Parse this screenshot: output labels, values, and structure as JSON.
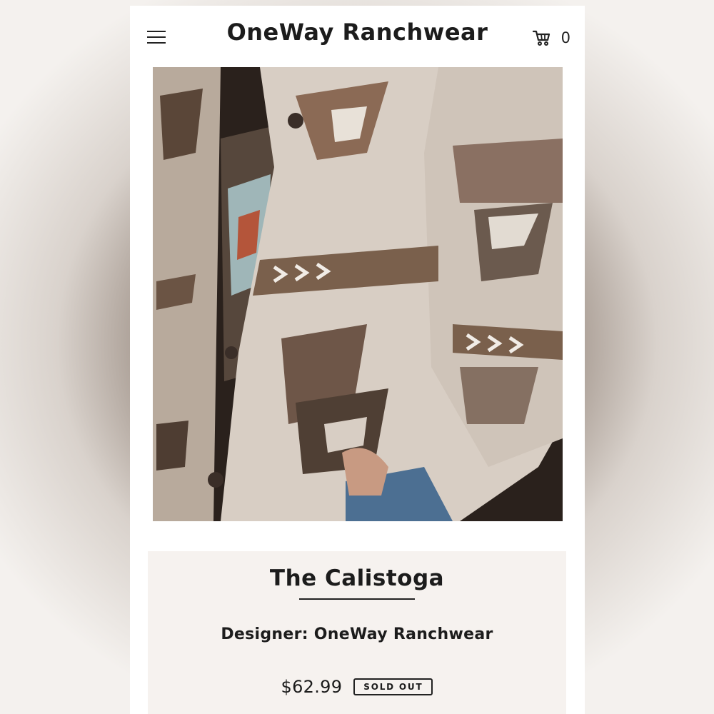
{
  "header": {
    "store_title": "OneWay Ranchwear",
    "cart_count": "0",
    "icons": {
      "menu": "hamburger-menu-icon",
      "cart": "shopping-cart-icon"
    }
  },
  "product": {
    "image_subject": "product-photo",
    "name": "The Calistoga",
    "designer": "Designer: OneWay Ranchwear",
    "price": "$62.99",
    "status_badge": "SOLD OUT"
  },
  "colors": {
    "text": "#1c1c1c",
    "panel_background": "#f6f2ef",
    "page_background": "#ffffff"
  }
}
